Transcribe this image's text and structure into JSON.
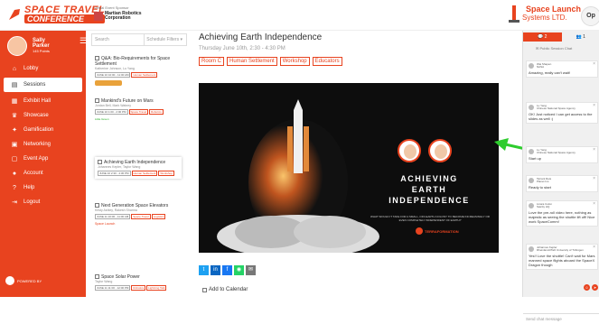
{
  "header": {
    "logo_line1": "SPACE TRAVEL",
    "logo_line2": "CONFERENCE",
    "sponsor_caption": "Virtual Event Sponsor",
    "sponsor_name_1": "Martian Robotics",
    "sponsor_name_2": "Corporation",
    "brand_name": "Space Launch",
    "brand_sub": "Systems LTD.",
    "user_initials": "Op"
  },
  "sidebar": {
    "user_name_1": "Sally",
    "user_name_2": "Parker",
    "points": "145 Points",
    "items": [
      {
        "label": "Lobby",
        "icon": "home-icon",
        "glyph": "⌂"
      },
      {
        "label": "Sessions",
        "icon": "sessions-icon",
        "glyph": "▤"
      },
      {
        "label": "Exhibit Hall",
        "icon": "exhibit-icon",
        "glyph": "▦"
      },
      {
        "label": "Showcase",
        "icon": "trophy-icon",
        "glyph": "♛"
      },
      {
        "label": "Gamification",
        "icon": "gift-icon",
        "glyph": "✦"
      },
      {
        "label": "Networking",
        "icon": "network-icon",
        "glyph": "▣"
      },
      {
        "label": "Event App",
        "icon": "mobile-icon",
        "glyph": "▢"
      },
      {
        "label": "Account",
        "icon": "account-icon",
        "glyph": "●"
      },
      {
        "label": "Help",
        "icon": "help-icon",
        "glyph": "?"
      },
      {
        "label": "Logout",
        "icon": "logout-icon",
        "glyph": "⇥"
      }
    ],
    "powered_by": "POWERED BY"
  },
  "schedule": {
    "search_placeholder": "Search",
    "filter_label": "Schedule Filters",
    "sessions": [
      {
        "title": "Q&A: Bio-Requirements for Space Settlement",
        "who": "Katherine Johnson, Lu Yang",
        "tags": [
          "JUNE 10 10:00 - 11:00 AM",
          "Human Settlement"
        ]
      },
      {
        "title": "Mankind's Future on Mars",
        "who": "Jordan Bell, Mark Watney",
        "tags": [
          "JUNE 10 1:00 - 2:00 PM",
          "Space Travel",
          "Robotics"
        ]
      },
      {
        "title": "Achieving Earth Independence",
        "who": "Johannes Kepler, Taylor Wang",
        "tags": [
          "JUNE 10 2:30 - 4:30 PM",
          "Human Settlement",
          "Workshop"
        ]
      },
      {
        "title": "Next Generation Space Elevators",
        "who": "Kristy Ashley, Rakesh Sharma",
        "tags": [
          "JUNE 11 10:00 - 11:00 AM",
          "Space Travel",
          "Logistics"
        ]
      },
      {
        "title": "Space Solar Power",
        "who": "Taylor Wang",
        "tags": [
          "JUNE 11 11:00 - 12:00 PM",
          "Robotics",
          "Lightning Talk"
        ]
      }
    ],
    "sponsor_1": "Space Launch",
    "sponsor_2": "Little Green"
  },
  "main": {
    "title": "Achieving Earth Independence",
    "date": "Thursday June 10th, 2:30 - 4:30 PM",
    "chips": [
      "Room C",
      "Human Settlement",
      "Workshop",
      "Educators"
    ],
    "video_title_1": "ACHIEVING",
    "video_title_2": "EARTH",
    "video_title_3": "INDEPENDENCE",
    "video_sub": "WHAT WOULD IT TAKE FOR A SMALL, OFF-EARTH COLONY TO BECOME INCREASINGLY OR EVEN COMPLETELY INDEPENDENT OF EARTH?",
    "video_brand": "TERRAFORMATION",
    "share_icons": [
      "twitter-icon",
      "linkedin-icon",
      "facebook-icon",
      "whatsapp-icon",
      "email-icon"
    ],
    "add_calendar": "Add to Calendar"
  },
  "chat": {
    "tab_chat_count": "2",
    "tab_people_count": "1",
    "label": "Public Session Chat",
    "messages": [
      {
        "name": "Wai Shapen",
        "org": "NASA",
        "text": "Amazing, really can't wait!"
      },
      {
        "name": "Lu Yang",
        "org": "Chinese National Space Agency",
        "text": "OK! Just noticed I can get access to the slides as well :)"
      },
      {
        "name": "Lu Yang",
        "org": "Chinese National Space Agency",
        "text": "Start up"
      },
      {
        "name": "Tarrant Reis",
        "org": "Planet Inc.",
        "text": "Ready to start"
      },
      {
        "name": "Linara Colon",
        "org": "Satcity HQ",
        "text": "Love the pre-roll video here, nothing as majestic as seeing the shuttle lift off! Nice work SpaceComm!"
      },
      {
        "name": "Johannes Kepler",
        "org": "Rheinland-Pfalz University of Tübingen",
        "text": "Yes!! Love the shuttle! Can't wait for Mars manned space flights aboard the SpaceX Dragon though"
      }
    ],
    "input_placeholder": "Send chat message"
  },
  "colors": {
    "accent": "#e8431f",
    "highlight": "#2ecc2e"
  }
}
